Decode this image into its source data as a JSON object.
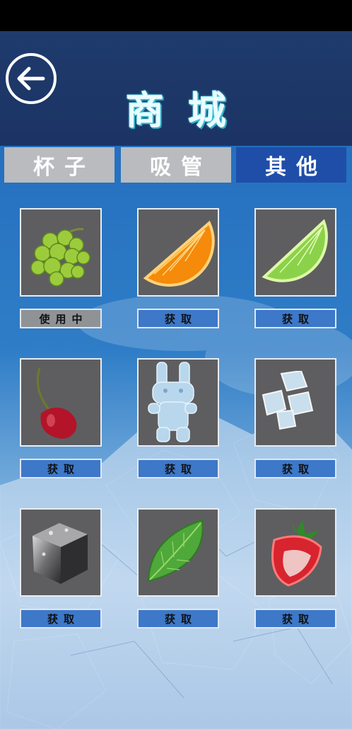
{
  "header": {
    "title": "商城",
    "back_icon": "arrow-left-icon"
  },
  "tabs": [
    {
      "label": "杯子",
      "active": false
    },
    {
      "label": "吸管",
      "active": false
    },
    {
      "label": "其他",
      "active": true
    }
  ],
  "items": [
    {
      "name": "grapes",
      "button": "使用中",
      "state": "in-use"
    },
    {
      "name": "orange-slice",
      "button": "获取",
      "state": "available"
    },
    {
      "name": "lime-slice",
      "button": "获取",
      "state": "available"
    },
    {
      "name": "cherry",
      "button": "获取",
      "state": "available"
    },
    {
      "name": "ice-rabbit",
      "button": "获取",
      "state": "available"
    },
    {
      "name": "ice-cubes",
      "button": "获取",
      "state": "available"
    },
    {
      "name": "steel-ice-cube",
      "button": "获取",
      "state": "available"
    },
    {
      "name": "mint-leaf",
      "button": "获取",
      "state": "available"
    },
    {
      "name": "strawberry",
      "button": "获取",
      "state": "available"
    }
  ],
  "colors": {
    "header_bg": "#1f3a6d",
    "tab_active": "#1f4ea9",
    "tab_inactive": "#b9bbbf",
    "button_bg": "#3d78c9",
    "button_inuse": "#909396",
    "tile_bg": "#5e5e60"
  }
}
